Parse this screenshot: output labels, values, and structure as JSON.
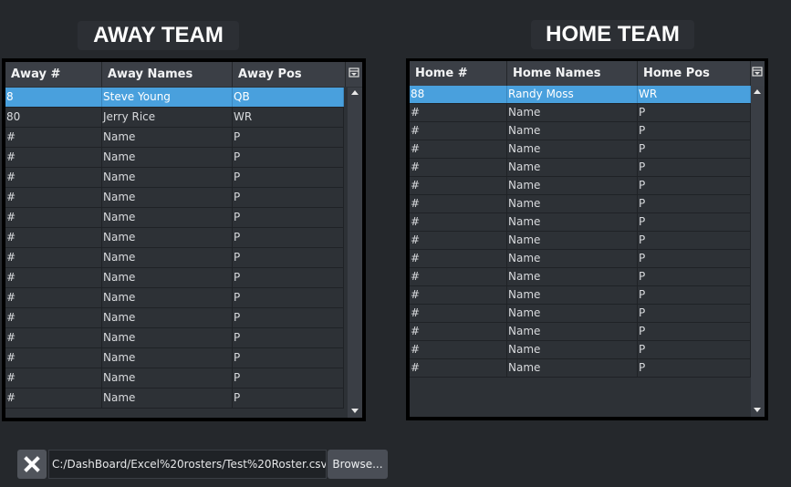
{
  "away": {
    "title": "AWAY TEAM",
    "columns": [
      "Away #",
      "Away Names",
      "Away Pos"
    ],
    "rows": [
      {
        "num": "8",
        "name": "Steve Young",
        "pos": "QB",
        "selected": true
      },
      {
        "num": "80",
        "name": "Jerry Rice",
        "pos": "WR"
      },
      {
        "num": "#",
        "name": "Name",
        "pos": "P"
      },
      {
        "num": "#",
        "name": "Name",
        "pos": "P"
      },
      {
        "num": "#",
        "name": "Name",
        "pos": "P"
      },
      {
        "num": "#",
        "name": "Name",
        "pos": "P"
      },
      {
        "num": "#",
        "name": "Name",
        "pos": "P"
      },
      {
        "num": "#",
        "name": "Name",
        "pos": "P"
      },
      {
        "num": "#",
        "name": "Name",
        "pos": "P"
      },
      {
        "num": "#",
        "name": "Name",
        "pos": "P"
      },
      {
        "num": "#",
        "name": "Name",
        "pos": "P"
      },
      {
        "num": "#",
        "name": "Name",
        "pos": "P"
      },
      {
        "num": "#",
        "name": "Name",
        "pos": "P"
      },
      {
        "num": "#",
        "name": "Name",
        "pos": "P"
      },
      {
        "num": "#",
        "name": "Name",
        "pos": "P"
      },
      {
        "num": "#",
        "name": "Name",
        "pos": "P"
      }
    ]
  },
  "home": {
    "title": "HOME TEAM",
    "columns": [
      "Home #",
      "Home Names",
      "Home Pos"
    ],
    "rows": [
      {
        "num": "88",
        "name": "Randy Moss",
        "pos": "WR",
        "selected": true
      },
      {
        "num": "#",
        "name": "Name",
        "pos": "P"
      },
      {
        "num": "#",
        "name": "Name",
        "pos": "P"
      },
      {
        "num": "#",
        "name": "Name",
        "pos": "P"
      },
      {
        "num": "#",
        "name": "Name",
        "pos": "P"
      },
      {
        "num": "#",
        "name": "Name",
        "pos": "P"
      },
      {
        "num": "#",
        "name": "Name",
        "pos": "P"
      },
      {
        "num": "#",
        "name": "Name",
        "pos": "P"
      },
      {
        "num": "#",
        "name": "Name",
        "pos": "P"
      },
      {
        "num": "#",
        "name": "Name",
        "pos": "P"
      },
      {
        "num": "#",
        "name": "Name",
        "pos": "P"
      },
      {
        "num": "#",
        "name": "Name",
        "pos": "P"
      },
      {
        "num": "#",
        "name": "Name",
        "pos": "P"
      },
      {
        "num": "#",
        "name": "Name",
        "pos": "P"
      },
      {
        "num": "#",
        "name": "Name",
        "pos": "P"
      },
      {
        "num": "#",
        "name": "Name",
        "pos": "P"
      }
    ]
  },
  "file_bar": {
    "clear_icon": "close-icon",
    "path_value": "C:/DashBoard/Excel%20rosters/Test%20Roster.csv",
    "browse_label": "Browse..."
  },
  "colors": {
    "background": "#25282c",
    "selection": "#49a0dd",
    "header": "#3b3f46"
  }
}
